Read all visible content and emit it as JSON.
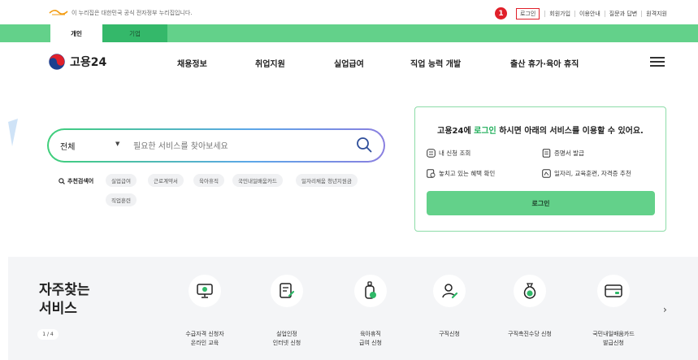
{
  "gov_notice": "이 누리집은 대한민국 공식 전자정부 누리집입니다.",
  "marker": "1",
  "util_links": [
    "로그인",
    "회원가입",
    "이용안내",
    "질문과 답변",
    "원격지원"
  ],
  "tabs": [
    "개인",
    "기업"
  ],
  "brand": "고용24",
  "menu": [
    "채용정보",
    "취업지원",
    "실업급여",
    "직업 능력 개발",
    "출산 휴가·육아 휴직"
  ],
  "search": {
    "scope": "전체",
    "placeholder": "필요한 서비스를 찾아보세요"
  },
  "recommend": {
    "title": "추천검색어",
    "chips": [
      "실업급여",
      "근로계약서",
      "육아휴직",
      "국민내일배움카드",
      "일자리채움 청년지원금",
      "직업훈련"
    ]
  },
  "login_card": {
    "title_pre": "고용24에 ",
    "title_hl": "로그인",
    "title_post": " 하시면 아래의 서비스를 이용할 수 있어요.",
    "items": [
      "내 신청 조회",
      "증명서 발급",
      "놓치고 있는 혜택 확인",
      "일자리, 교육훈련, 자격증 추천"
    ],
    "button": "로그인",
    "accent": "#1fae5a"
  },
  "services": {
    "title": "자주찾는\n서비스",
    "pager": "1 / 4",
    "items": [
      {
        "label": "수급자격 신청자\n온라인 교육",
        "icon": "monitor-play-icon"
      },
      {
        "label": "실업인정\n인터넷 신청",
        "icon": "document-pen-icon"
      },
      {
        "label": "육아휴직\n급여 신청",
        "icon": "baby-bottle-icon"
      },
      {
        "label": "구직신청",
        "icon": "person-pen-icon"
      },
      {
        "label": "구직촉진수당 신청",
        "icon": "money-bag-icon"
      },
      {
        "label": "국민내일배움카드\n발급신청",
        "icon": "card-icon"
      }
    ]
  },
  "colors": {
    "brand_green": "#63d18a",
    "dark_green": "#34b86a",
    "marker_red": "#e0202a"
  }
}
